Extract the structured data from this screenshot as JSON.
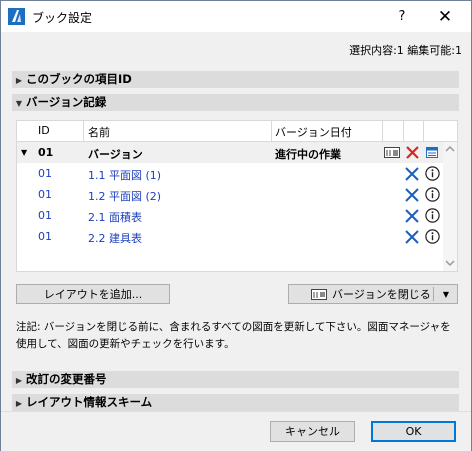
{
  "window": {
    "title": "ブック設定",
    "help_label": "?",
    "close_label": "✕"
  },
  "selection_info": "選択内容:1 編集可能:1",
  "sections": {
    "book_item_id": "このブックの項目ID",
    "version_history": "バージョン記録",
    "revision_change_number": "改訂の変更番号",
    "layout_info_scheme": "レイアウト情報スキーム"
  },
  "table": {
    "headers": {
      "id": "ID",
      "name": "名前",
      "version_date": "バージョン日付"
    },
    "group_row": {
      "id": "01",
      "name": "バージョン",
      "status": "進行中の作業"
    },
    "rows": [
      {
        "id": "01",
        "name": "1.1 平面図 (1)"
      },
      {
        "id": "01",
        "name": "1.2 平面図 (2)"
      },
      {
        "id": "01",
        "name": "2.1 面積表"
      },
      {
        "id": "01",
        "name": "2.2 建具表"
      }
    ]
  },
  "buttons": {
    "add_layout": "レイアウトを追加...",
    "close_version": "バージョンを閉じる",
    "cancel": "キャンセル",
    "ok": "OK"
  },
  "note": "注記: バージョンを閉じる前に、含まれるすべての図面を更新して下さい。図面マネージャを使用して、図面の更新やチェックを行います。",
  "icons": {
    "delete": "x-icon",
    "info": "info-icon"
  },
  "colors": {
    "accent": "#1c3fbd",
    "delete_red": "#e0221f",
    "selected_border": "#0078d7"
  }
}
